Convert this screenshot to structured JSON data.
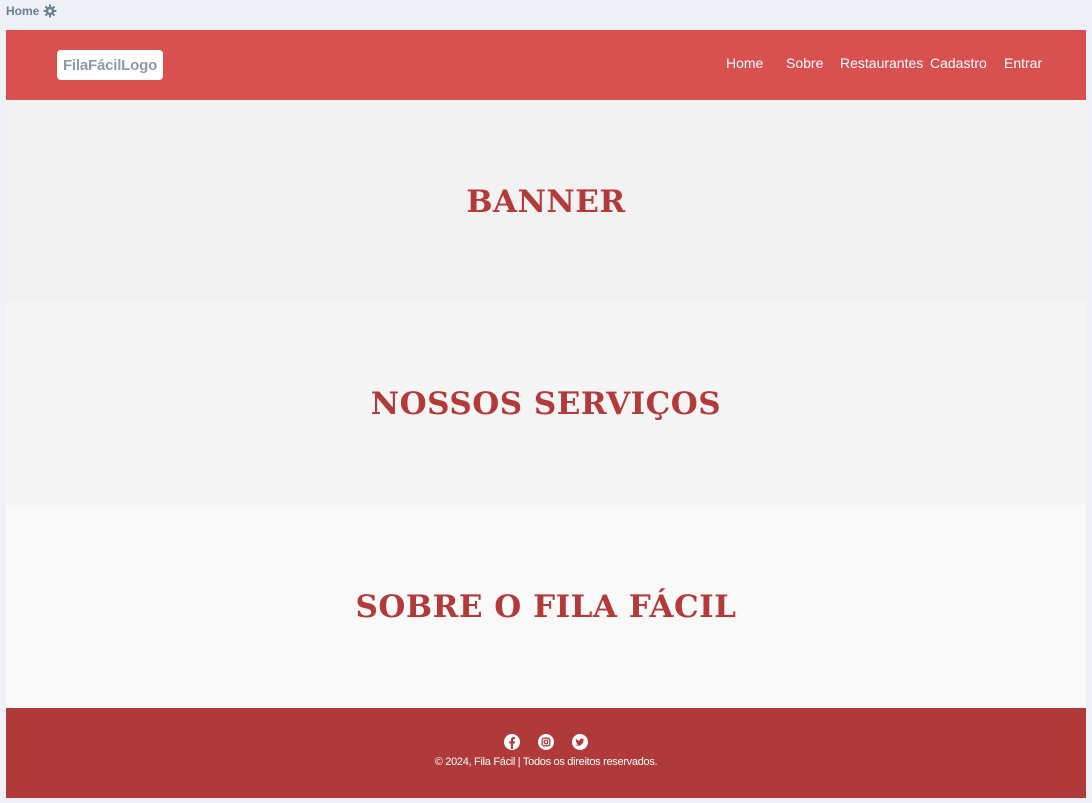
{
  "breadcrumb": {
    "label": "Home",
    "icon": "gear-icon"
  },
  "colors": {
    "navbar": "#d95050",
    "footer": "#b03a3a",
    "heading": "#b33a3a"
  },
  "header": {
    "logo_text": "FilaFácilLogo",
    "nav": [
      "Home",
      "Sobre",
      "Restaurantes",
      "Cadastro",
      "Entrar"
    ]
  },
  "sections": {
    "banner": "BANNER",
    "services": "NOSSOS SERVIÇOS",
    "about": "SOBRE O FILA FÁCIL"
  },
  "footer": {
    "social_icons": [
      "facebook-icon",
      "instagram-icon",
      "twitter-icon"
    ],
    "copyright": "© 2024, Fila Fácil | Todos os direitos reservados."
  }
}
